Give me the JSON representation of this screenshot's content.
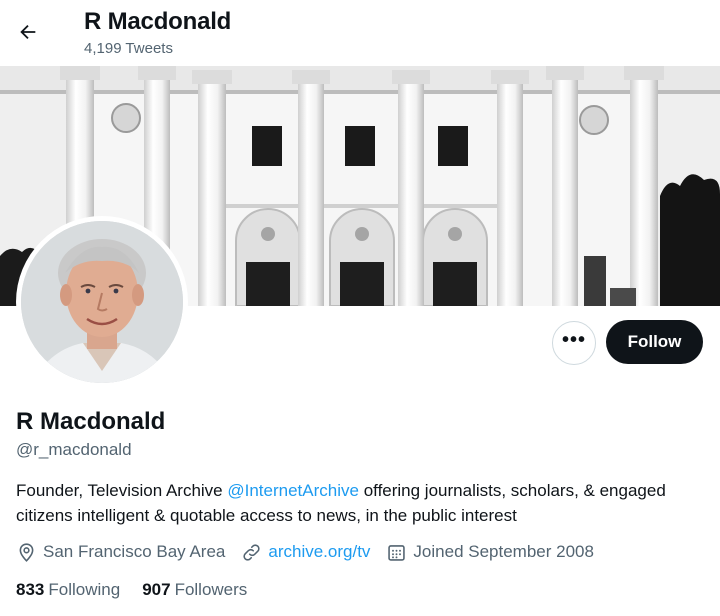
{
  "header": {
    "name": "R Macdonald",
    "tweet_count": "4,199 Tweets",
    "back_icon": "arrow-left-icon"
  },
  "banner": {
    "icon": "building-columns-image"
  },
  "actions": {
    "more_label": "•••",
    "follow_label": "Follow"
  },
  "profile": {
    "display_name": "R Macdonald",
    "handle": "@r_macdonald",
    "bio_before": "Founder, Television Archive ",
    "bio_mention": "@InternetArchive",
    "bio_after": " offering journalists, scholars, & engaged citizens intelligent & quotable access to news, in the public interest",
    "location": "San Francisco Bay Area",
    "website": "archive.org/tv",
    "joined": "Joined September 2008"
  },
  "stats": {
    "following_count": "833",
    "following_label": "Following",
    "followers_count": "907",
    "followers_label": "Followers"
  },
  "colors": {
    "accent": "#1d9bf0",
    "text": "#0f1419",
    "muted": "#536471",
    "follow_button": "#0f1419"
  }
}
